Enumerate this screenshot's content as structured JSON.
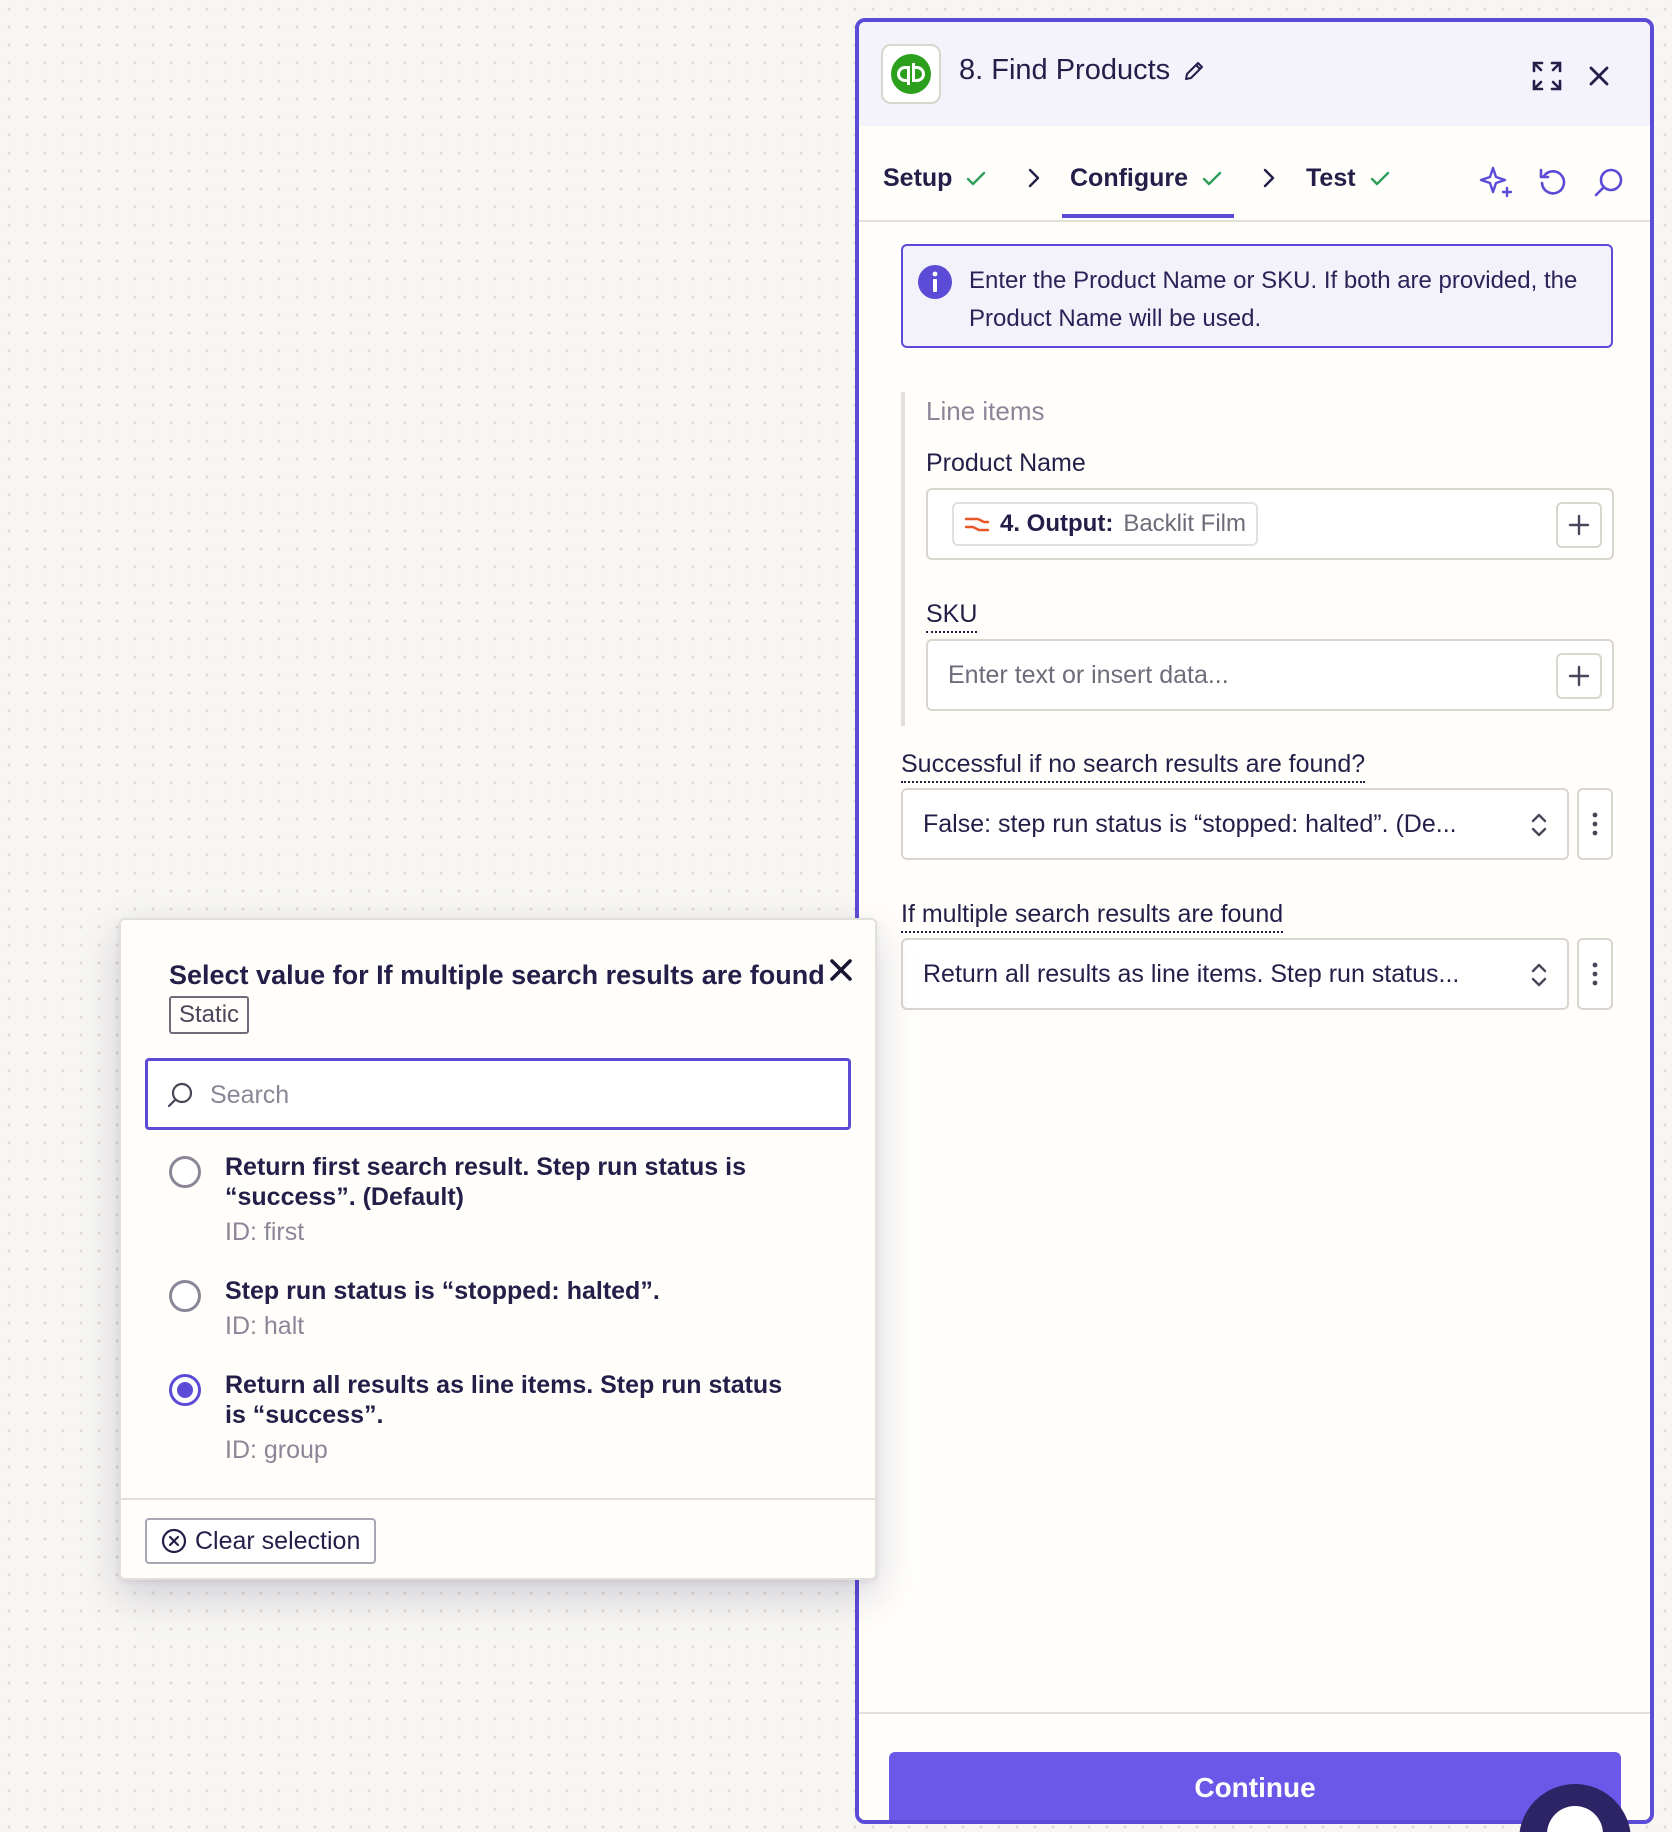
{
  "panel": {
    "step_title": "8. Find Products",
    "app_icon": "quickbooks-icon",
    "tabs": [
      {
        "label": "Setup",
        "status": "complete"
      },
      {
        "label": "Configure",
        "status": "complete"
      },
      {
        "label": "Test",
        "status": "complete"
      }
    ],
    "active_tab": "Configure",
    "info_message": "Enter the Product Name or SKU. If both are provided, the Product Name will be used.",
    "section_label": "Line items",
    "fields": {
      "product_name": {
        "label": "Product Name",
        "pill_step": "4. Output:",
        "pill_value": "Backlit Film"
      },
      "sku": {
        "label": "SKU",
        "placeholder": "Enter text or insert data..."
      },
      "no_results": {
        "label": "Successful if no search results are found?",
        "value": "False: step run status is “stopped: halted”. (De..."
      },
      "multiple_results": {
        "label": "If multiple search results are found",
        "value": "Return all results as line items. Step run status..."
      }
    },
    "continue_label": "Continue"
  },
  "popover": {
    "title": "Select value for If multiple search results are found",
    "badge": "Static",
    "search_placeholder": "Search",
    "options": [
      {
        "label": "Return first search result. Step run status is “success”. (Default)",
        "id": "ID: first",
        "selected": false
      },
      {
        "label": "Step run status is “stopped: halted”.",
        "id": "ID: halt",
        "selected": false
      },
      {
        "label": "Return all results as line items. Step run status is “success”.",
        "id": "ID: group",
        "selected": true
      }
    ],
    "clear_label": "Clear selection"
  },
  "colors": {
    "accent": "#5b4bd6",
    "button": "#6b57e8",
    "success": "#2e9e5b",
    "quickbooks": "#2ca01c"
  }
}
